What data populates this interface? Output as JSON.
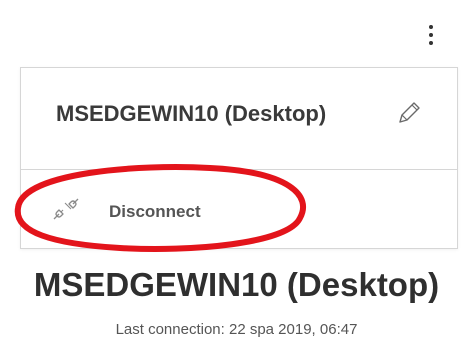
{
  "menu_button": {
    "icon": "kebab-menu-icon"
  },
  "context_menu": {
    "rename_item": {
      "label": "MSEDGEWIN10 (Desktop)",
      "icon": "pencil-icon"
    },
    "disconnect_item": {
      "label": "Disconnect",
      "icon": "disconnect-plug-icon"
    }
  },
  "annotation": {
    "shape": "ellipse",
    "color": "#e3141b"
  },
  "device": {
    "title": "MSEDGEWIN10 (Desktop)",
    "last_connection": "Last connection: 22 spa 2019, 06:47"
  }
}
